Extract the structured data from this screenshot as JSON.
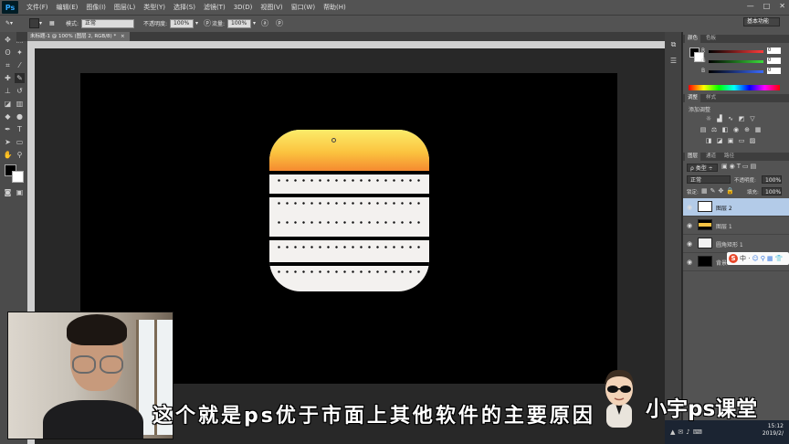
{
  "app": {
    "logo": "Ps"
  },
  "menu": [
    "文件(F)",
    "编辑(E)",
    "图像(I)",
    "图层(L)",
    "类型(Y)",
    "选择(S)",
    "滤镜(T)",
    "3D(D)",
    "视图(V)",
    "窗口(W)",
    "帮助(H)"
  ],
  "window_controls": [
    "—",
    "□",
    "✕"
  ],
  "options_bar": {
    "mode_label": "模式:",
    "mode_value": "正常",
    "opacity_label": "不透明度:",
    "opacity_value": "100%",
    "flow_label": "流量:",
    "flow_value": "100%",
    "workspace": "基本功能"
  },
  "document_tab": {
    "title": "未标题-1 @ 100% (图层 2, RGB/8) *",
    "close": "×"
  },
  "color_panel": {
    "tabs": [
      "颜色",
      "色板"
    ],
    "rows": [
      {
        "label": "R",
        "value": "0",
        "color": "#ff3b3b"
      },
      {
        "label": "G",
        "value": "0",
        "color": "#3bdc3b"
      },
      {
        "label": "B",
        "value": "0",
        "color": "#3b6bff"
      }
    ]
  },
  "adjust_panel": {
    "tabs": [
      "调整",
      "样式"
    ],
    "title": "添加调整",
    "icons": [
      "brightness-icon",
      "levels-icon",
      "curves-icon",
      "exposure-icon",
      "vibrance-icon",
      "hue-icon",
      "balance-icon",
      "bw-icon",
      "photo-filter-icon",
      "channel-mixer-icon",
      "lookup-icon",
      "invert-icon",
      "posterize-icon",
      "threshold-icon",
      "gradient-map-icon",
      "selective-color-icon"
    ]
  },
  "layers_panel": {
    "tabs": [
      "图层",
      "通道",
      "路径"
    ],
    "kind_filter": "ρ 类型 ÷",
    "blend_mode": "正常",
    "opacity_label": "不透明度:",
    "opacity_value": "100%",
    "lock_label": "锁定:",
    "fill_label": "填充:",
    "fill_value": "100%",
    "layers": [
      {
        "name": "图层 2",
        "selected": true
      },
      {
        "name": "图层 1",
        "selected": false
      },
      {
        "name": "圆角矩形 1",
        "selected": false
      },
      {
        "name": "背景",
        "selected": false
      }
    ]
  },
  "ime": {
    "logo": "S",
    "text": "中 ·"
  },
  "subtitle": "这个就是ps优于市面上其他软件的主要原因",
  "brand": "小宇ps课堂",
  "taskbar": {
    "time": "15:12",
    "date": "2019/2/"
  }
}
